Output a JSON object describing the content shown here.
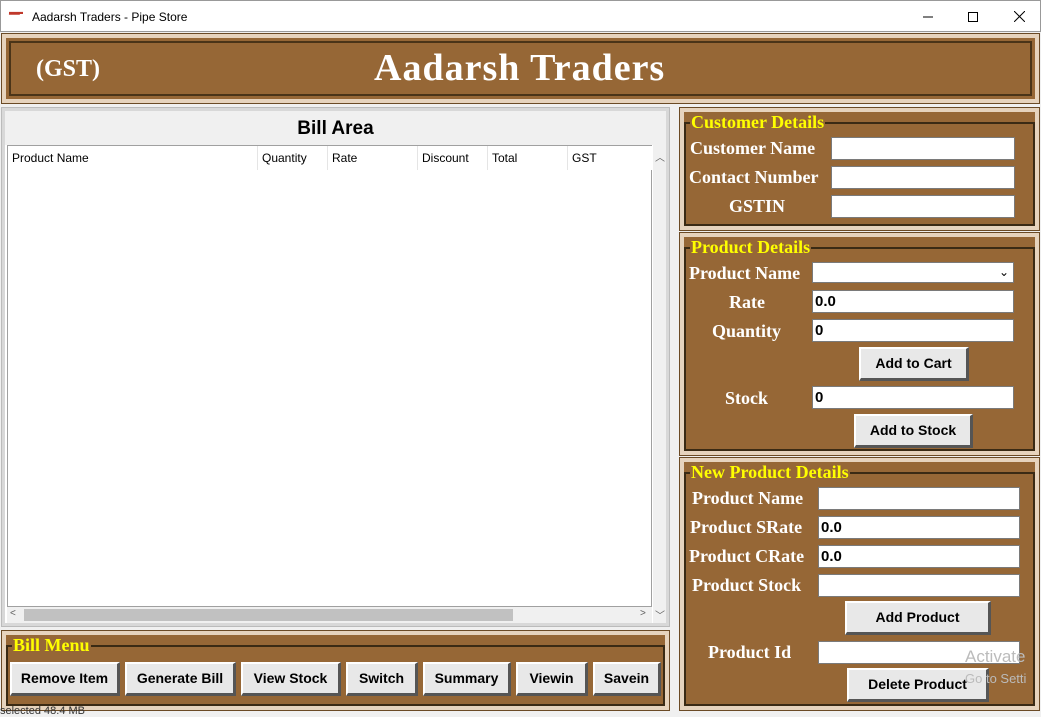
{
  "window": {
    "title": "Aadarsh Traders - Pipe Store",
    "icon": "app-icon"
  },
  "header": {
    "gst": "(GST)",
    "brand": "Aadarsh Traders"
  },
  "bill": {
    "title": "Bill Area",
    "columns": [
      "Product Name",
      "Quantity",
      "Rate",
      "Discount",
      "Total",
      "GST"
    ]
  },
  "bill_menu": {
    "legend": "Bill Menu",
    "buttons": [
      "Remove Item",
      "Generate Bill",
      "View Stock",
      "Switch",
      "Summary",
      "Viewin",
      "Savein"
    ]
  },
  "customer": {
    "legend": "Customer Details",
    "name_label": "Customer Name",
    "contact_label": "Contact Number",
    "gstin_label": "GSTIN",
    "name_value": "",
    "contact_value": "",
    "gstin_value": ""
  },
  "product": {
    "legend": "Product Details",
    "name_label": "Product Name",
    "name_value": "",
    "rate_label": "Rate",
    "rate_value": "0.0",
    "qty_label": "Quantity",
    "qty_value": "0",
    "add_cart": "Add to Cart",
    "stock_label": "Stock",
    "stock_value": "0",
    "add_stock": "Add to Stock"
  },
  "new_product": {
    "legend": "New Product Details",
    "name_label": "Product Name",
    "name_value": "",
    "srate_label": "Product SRate",
    "srate_value": "0.0",
    "crate_label": "Product CRate",
    "crate_value": "0.0",
    "stock_label": "Product Stock",
    "stock_value": "",
    "add_product": "Add Product",
    "id_label": "Product Id",
    "id_value": "",
    "delete_product": "Delete Product"
  },
  "status_text": "selected 48.4 MB",
  "watermark": {
    "line1": "Activate",
    "line2": "Go to Setti"
  },
  "colors": {
    "panel": "#966736",
    "legend": "#ffff00",
    "label": "#ffffff"
  }
}
